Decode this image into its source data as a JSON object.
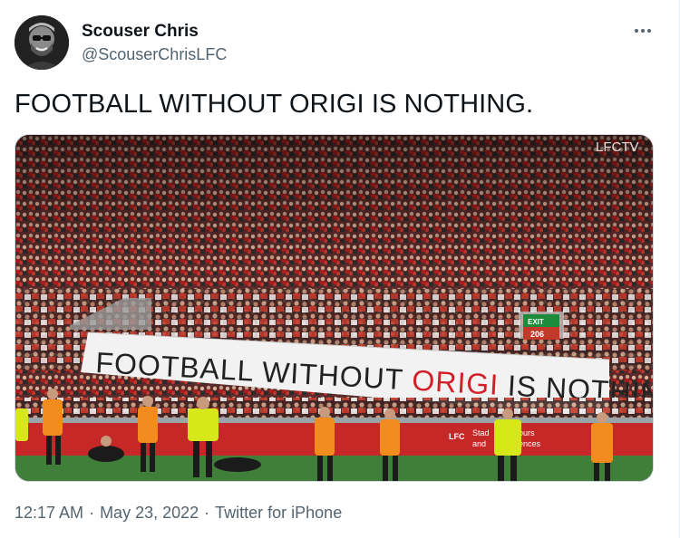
{
  "author": {
    "display_name": "Scouser Chris",
    "handle": "@ScouserChrisLFC",
    "avatar_icon": "profile-avatar"
  },
  "more_icon": "more-horizontal-icon",
  "tweet": {
    "text": "FOOTBALL WITHOUT ORIGI IS NOTHING."
  },
  "media": {
    "watermark": "LFCTV",
    "banner_text_part1": "FOOTBALL WITHOUT ",
    "banner_text_highlight": "ORIGI",
    "banner_text_part2": " IS NOTHING",
    "exit_sign": "EXIT",
    "exit_number": "206",
    "board_text_1": "Stad",
    "board_text_2": "and",
    "board_text_3": "ours",
    "board_text_4": "ences",
    "board_logo": "LFC"
  },
  "meta": {
    "time": "12:17 AM",
    "separator": "·",
    "date": "May 23, 2022",
    "source": "Twitter for iPhone"
  },
  "colors": {
    "text": "#0f1419",
    "secondary": "#536471",
    "crowd_red": "#b01c1c",
    "pitch_green": "#3f7f3a"
  }
}
